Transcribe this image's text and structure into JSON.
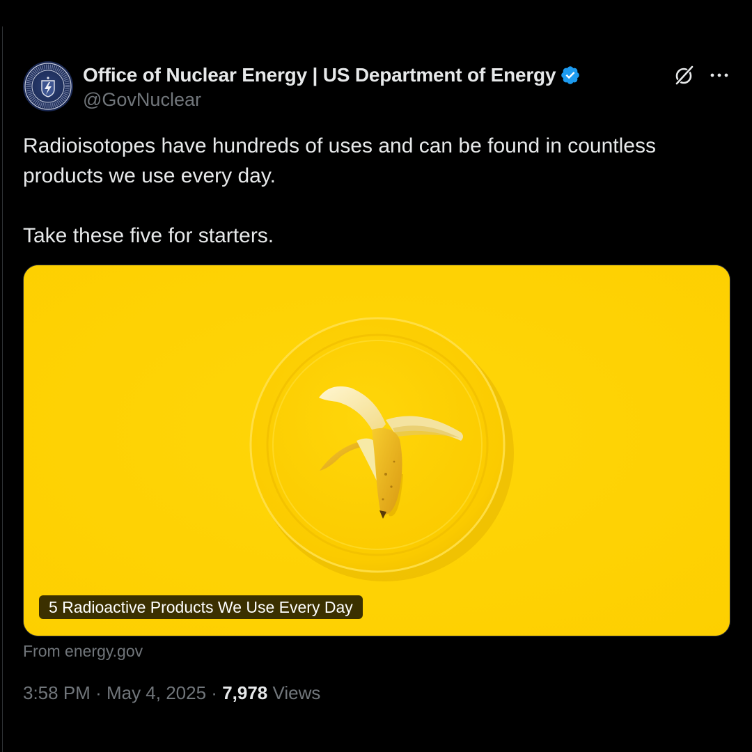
{
  "post": {
    "author": {
      "display_name": "Office of Nuclear Energy | US Department of Energy",
      "handle": "@GovNuclear",
      "verified": true,
      "verified_color": "#1d9bf0",
      "avatar_icon": "department-of-energy-seal-icon",
      "avatar_seal_text": "DEPARTMENT OF ENERGY · UNITED STATES OF AMERICA"
    },
    "text": "Radioisotopes have hundreds of uses and can be found in countless products we use every day.\n\nTake these five for starters.",
    "link_card": {
      "title": "5 Radioactive Products We Use Every Day",
      "source": "From energy.gov",
      "image_icon": "banana-on-plate-image",
      "background_color": "#ffd303"
    },
    "meta": {
      "time": "3:58 PM",
      "separator": "·",
      "date": "May 4, 2025",
      "views_count": "7,978",
      "views_label": "Views"
    },
    "actions": {
      "grok_icon": "grok-icon",
      "more_icon": "more-options-icon"
    }
  },
  "theme": {
    "background": "#000000",
    "primary_text": "#e7e9ea",
    "secondary_text": "#71767b"
  }
}
